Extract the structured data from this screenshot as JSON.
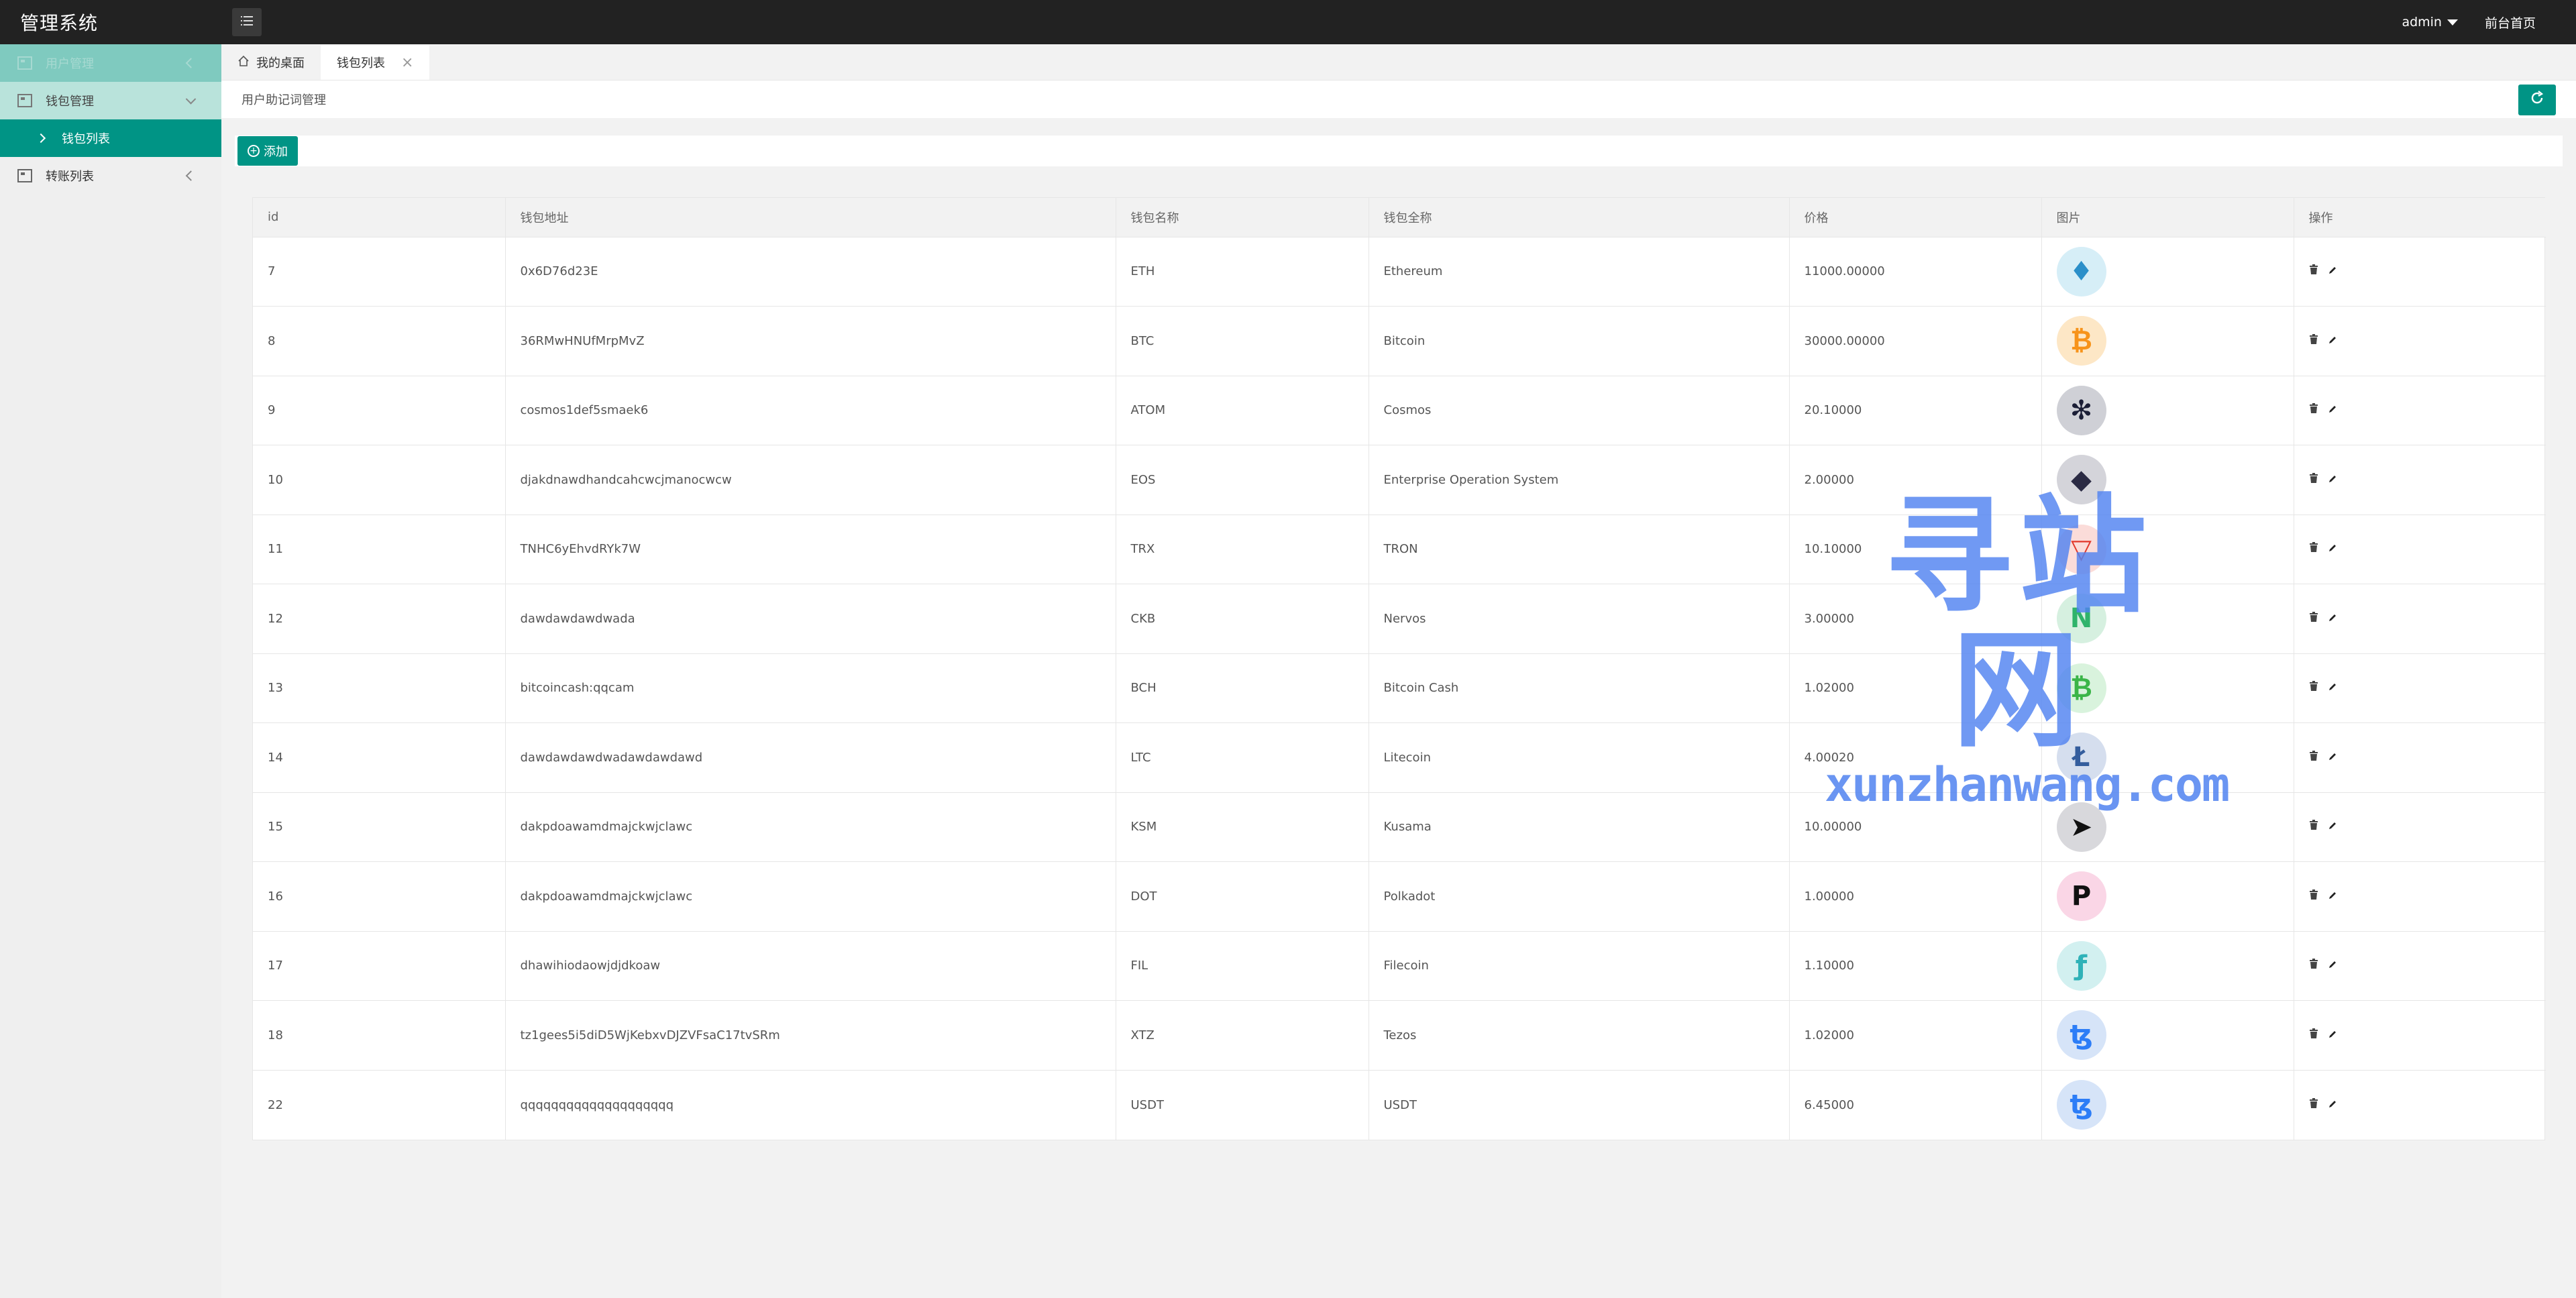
{
  "app": {
    "title": "管理系统"
  },
  "topbar": {
    "user": "admin",
    "frontend_link": "前台首页"
  },
  "sidebar": {
    "items": [
      {
        "label": "用户管理",
        "state": "faded"
      },
      {
        "label": "钱包管理",
        "state": "open"
      },
      {
        "label": "钱包列表",
        "state": "active"
      },
      {
        "label": "转账列表",
        "state": "normal"
      }
    ]
  },
  "tabs": [
    {
      "label": "我的桌面"
    },
    {
      "label": "钱包列表"
    }
  ],
  "section": {
    "title": "用户助记词管理"
  },
  "toolbar": {
    "add_label": "添加"
  },
  "table": {
    "headers": [
      "id",
      "钱包地址",
      "钱包名称",
      "钱包全称",
      "价格",
      "图片",
      "操作"
    ],
    "rows": [
      {
        "id": "7",
        "address": "0x6D76d23E",
        "name": "ETH",
        "fullname": "Ethereum",
        "price": "11000.00000",
        "icon": "ethereum-icon",
        "glyph": "♦",
        "bg": "#d6eef7",
        "fg": "#2b8fc9"
      },
      {
        "id": "8",
        "address": "36RMwHNUfMrpMvZ",
        "name": "BTC",
        "fullname": "Bitcoin",
        "price": "30000.00000",
        "icon": "bitcoin-icon",
        "glyph": "₿",
        "bg": "#fde7c6",
        "fg": "#f7931a"
      },
      {
        "id": "9",
        "address": "cosmos1def5smaek6",
        "name": "ATOM",
        "fullname": "Cosmos",
        "price": "20.10000",
        "icon": "cosmos-icon",
        "glyph": "✻",
        "bg": "#cfd0d6",
        "fg": "#1b1e36"
      },
      {
        "id": "10",
        "address": "djakdnawdhandcahcwcjmanocwcw",
        "name": "EOS",
        "fullname": "Enterprise Operation System",
        "price": "2.00000",
        "icon": "eos-icon",
        "glyph": "◆",
        "bg": "#d4d4da",
        "fg": "#2b2b44"
      },
      {
        "id": "11",
        "address": "TNHC6yEhvdRYk7W",
        "name": "TRX",
        "fullname": "TRON",
        "price": "10.10000",
        "icon": "tron-icon",
        "glyph": "▽",
        "bg": "#fbdcd9",
        "fg": "#e2392c"
      },
      {
        "id": "12",
        "address": "dawdawdawdwada",
        "name": "CKB",
        "fullname": "Nervos",
        "price": "3.00000",
        "icon": "nervos-icon",
        "glyph": "N",
        "bg": "#d6f0e0",
        "fg": "#2fb36b"
      },
      {
        "id": "13",
        "address": "bitcoincash:qqcam",
        "name": "BCH",
        "fullname": "Bitcoin Cash",
        "price": "1.02000",
        "icon": "bitcoin-cash-icon",
        "glyph": "₿",
        "bg": "#d9f3dd",
        "fg": "#3bb548"
      },
      {
        "id": "14",
        "address": "dawdawdawdwadawdawdawd",
        "name": "LTC",
        "fullname": "Litecoin",
        "price": "4.00020",
        "icon": "litecoin-icon",
        "glyph": "Ł",
        "bg": "#d5deee",
        "fg": "#345d9d"
      },
      {
        "id": "15",
        "address": "dakpdoawamdmajckwjclawc",
        "name": "KSM",
        "fullname": "Kusama",
        "price": "10.00000",
        "icon": "kusama-icon",
        "glyph": "➤",
        "bg": "#d8d8dc",
        "fg": "#111"
      },
      {
        "id": "16",
        "address": "dakpdoawamdmajckwjclawc",
        "name": "DOT",
        "fullname": "Polkadot",
        "price": "1.00000",
        "icon": "polkadot-icon",
        "glyph": "P",
        "bg": "#fad6e6",
        "fg": "#111"
      },
      {
        "id": "17",
        "address": "dhawihiodaowjdjdkoaw",
        "name": "FIL",
        "fullname": "Filecoin",
        "price": "1.10000",
        "icon": "filecoin-icon",
        "glyph": "ƒ",
        "bg": "#d2f0f0",
        "fg": "#2fb2b8"
      },
      {
        "id": "18",
        "address": "tz1gees5i5diD5WjKebxvDJZVFsaC17tvSRm",
        "name": "XTZ",
        "fullname": "Tezos",
        "price": "1.02000",
        "icon": "tezos-icon",
        "glyph": "ꜩ",
        "bg": "#d6e4f8",
        "fg": "#2c7df7"
      },
      {
        "id": "22",
        "address": "qqqqqqqqqqqqqqqqqqqq",
        "name": "USDT",
        "fullname": "USDT",
        "price": "6.45000",
        "icon": "tezos-icon",
        "glyph": "ꜩ",
        "bg": "#d6e4f8",
        "fg": "#2c7df7"
      }
    ]
  },
  "watermark": {
    "cn": "寻站网",
    "en": "xunzhanwang.com"
  },
  "colors": {
    "accent": "#009485",
    "topbar": "#222222"
  }
}
